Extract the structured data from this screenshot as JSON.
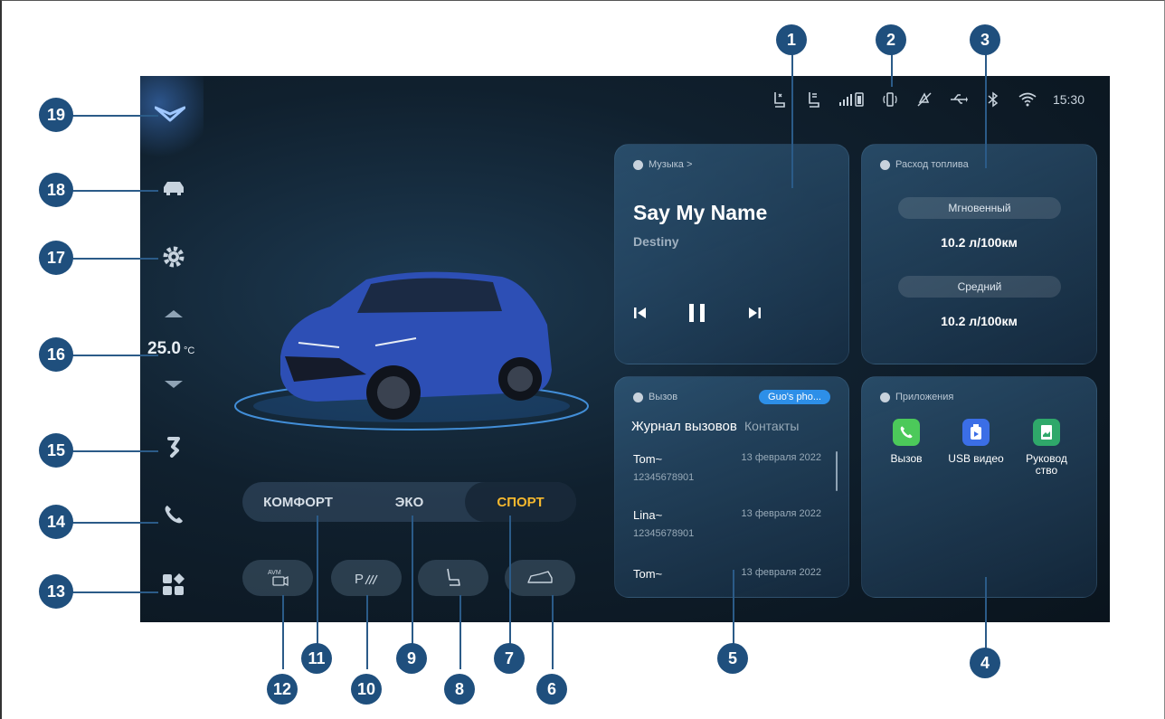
{
  "status_bar": {
    "time": "15:30"
  },
  "sidebar": {
    "temperature": "25.0",
    "temperature_unit": "°C"
  },
  "music": {
    "header": "Музыка >",
    "title": "Say My Name",
    "artist": "Destiny"
  },
  "fuel": {
    "header": "Расход топлива",
    "instant_label": "Мгновенный",
    "instant_value": "10.2 л/100км",
    "average_label": "Средний",
    "average_value": "10.2 л/100км"
  },
  "calls": {
    "header": "Вызов",
    "device_badge": "Guo's pho...",
    "tab_log": "Журнал вызовов",
    "tab_contacts": "Контакты",
    "entries": [
      {
        "name": "Tom~",
        "date": "13 февраля 2022",
        "number": "12345678901"
      },
      {
        "name": "Lina~",
        "date": "13 февраля 2022",
        "number": "12345678901"
      },
      {
        "name": "Tom~",
        "date": "13 февраля 2022"
      }
    ]
  },
  "apps": {
    "header": "Приложения",
    "items": [
      {
        "label": "Вызов"
      },
      {
        "label": "USB видео"
      },
      {
        "label": "Руковод ство"
      }
    ]
  },
  "drive_modes": {
    "comfort": "КОМФОРТ",
    "eco": "ЭКО",
    "sport": "СПОРТ",
    "active": "СПОРТ"
  },
  "func_buttons": {
    "avm": "AVM"
  },
  "callouts": [
    "1",
    "2",
    "3",
    "4",
    "5",
    "6",
    "7",
    "8",
    "9",
    "10",
    "11",
    "12",
    "13",
    "14",
    "15",
    "16",
    "17",
    "18",
    "19"
  ],
  "colors": {
    "accent": "#f5b82e",
    "callout": "#1f4f7d"
  }
}
